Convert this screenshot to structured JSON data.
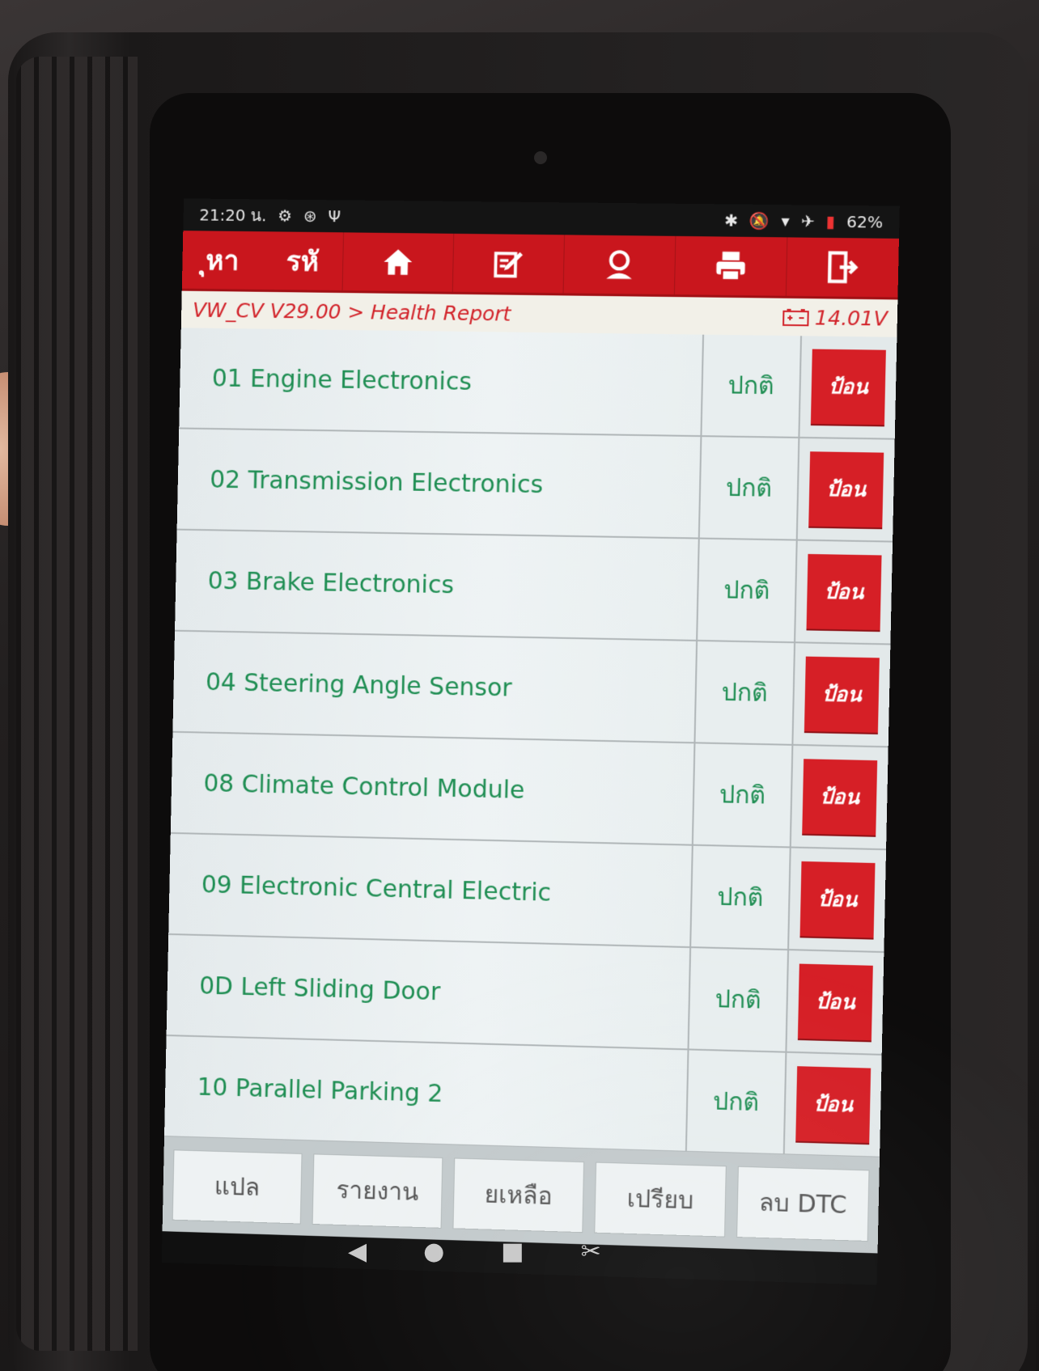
{
  "status_bar": {
    "time": "21:20 น.",
    "left_icons": [
      "gear-icon",
      "bluetooth-badge-icon",
      "usb-icon"
    ],
    "right_icons": [
      "bluetooth-icon",
      "mute-icon",
      "wifi-icon",
      "airplane-icon",
      "battery-icon"
    ],
    "battery": "62%"
  },
  "toolbar": {
    "search_label": "ุหา",
    "code_label": "รหั",
    "icons": [
      "home-icon",
      "edit-report-icon",
      "user-icon",
      "print-icon",
      "exit-icon"
    ],
    "accent_color": "#c9161d"
  },
  "breadcrumb": {
    "path": "VW_CV V29.00 > Health Report",
    "voltage": "14.01V"
  },
  "modules": [
    {
      "name": "01 Engine Electronics",
      "status": "ปกติ",
      "action": "ป้อน"
    },
    {
      "name": "02 Transmission Electronics",
      "status": "ปกติ",
      "action": "ป้อน"
    },
    {
      "name": "03 Brake Electronics",
      "status": "ปกติ",
      "action": "ป้อน"
    },
    {
      "name": "04 Steering Angle Sensor",
      "status": "ปกติ",
      "action": "ป้อน"
    },
    {
      "name": "08 Climate Control Module",
      "status": "ปกติ",
      "action": "ป้อน"
    },
    {
      "name": "09 Electronic Central Electric",
      "status": "ปกติ",
      "action": "ป้อน"
    },
    {
      "name": "0D Left Sliding Door",
      "status": "ปกติ",
      "action": "ป้อน"
    },
    {
      "name": "10 Parallel Parking 2",
      "status": "ปกติ",
      "action": "ป้อน"
    }
  ],
  "bottom_buttons": [
    "แปล",
    "รายงาน",
    "ยเหลือ",
    "เปรียบ",
    "ลบ DTC"
  ],
  "system_nav": [
    "back-icon",
    "home-dot-icon",
    "recents-icon",
    "screenshot-icon"
  ]
}
